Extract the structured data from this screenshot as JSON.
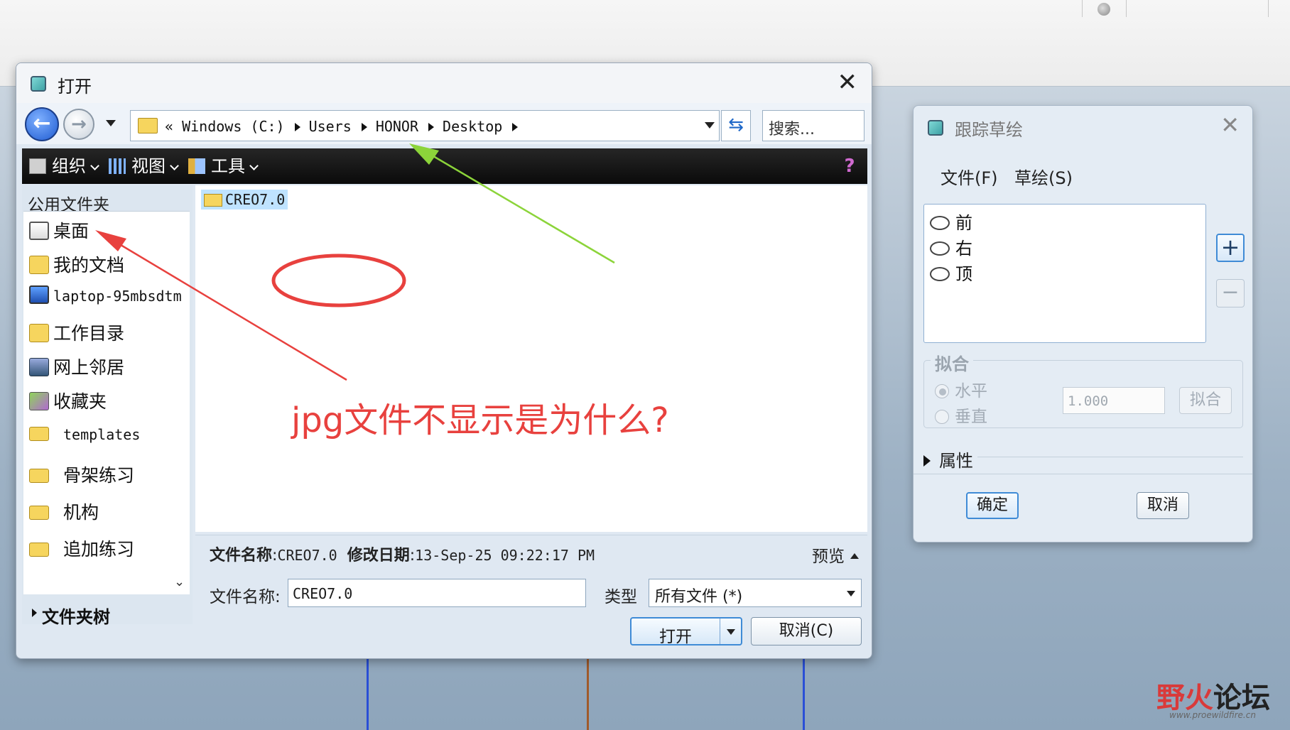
{
  "open_dialog": {
    "title": "打开",
    "close": "✕",
    "breadcrumb": {
      "prefix": "«",
      "parts": [
        "Windows (C:)",
        "Users",
        "HONOR",
        "Desktop"
      ]
    },
    "search_placeholder": "搜索...",
    "toolbar": {
      "organize": "组织",
      "view": "视图",
      "tools": "工具"
    },
    "sidebar": {
      "header": "公用文件夹",
      "items": [
        {
          "label": "桌面",
          "icon": "desktop-icon"
        },
        {
          "label": "我的文档",
          "icon": "documents-icon"
        },
        {
          "label": "laptop-95mbsdtm",
          "icon": "computer-icon"
        },
        {
          "label": "工作目录",
          "icon": "work-dir-icon"
        },
        {
          "label": "网上邻居",
          "icon": "network-icon"
        },
        {
          "label": "收藏夹",
          "icon": "favorites-icon"
        },
        {
          "label": "templates",
          "icon": "folder-icon"
        },
        {
          "label": "骨架练习",
          "icon": "folder-icon"
        },
        {
          "label": "机构",
          "icon": "folder-icon"
        },
        {
          "label": "追加练习",
          "icon": "folder-icon"
        }
      ],
      "folder_tree": "文件夹树"
    },
    "files": [
      {
        "name": "CREO7.0"
      }
    ],
    "info": {
      "name_label": "文件名称",
      "name_value": "CREO7.0",
      "date_label": "修改日期",
      "date_value": "13-Sep-25 09:22:17 PM",
      "preview": "预览"
    },
    "filename_label": "文件名称:",
    "filename_value": "CREO7.0",
    "type_label": "类型",
    "type_value": "所有文件 (*)",
    "open_button": "打开",
    "cancel_button": "取消(C)"
  },
  "annotation": {
    "text": "jpg文件不显示是为什么?",
    "color": "#e8413e"
  },
  "sketch_dialog": {
    "title": "跟踪草绘",
    "close": "✕",
    "menu": [
      "文件(F)",
      "草绘(S)"
    ],
    "items": [
      "前",
      "右",
      "顶"
    ],
    "add": "+",
    "remove": "−",
    "fit_group": "拟合",
    "horizontal": "水平",
    "vertical": "垂直",
    "fit_value": "1.000",
    "fit_button": "拟合",
    "properties": "属性",
    "ok": "确定",
    "cancel": "取消"
  },
  "watermark": {
    "part1": "野火",
    "part2": "论坛",
    "url": "www.proewildfire.cn"
  }
}
